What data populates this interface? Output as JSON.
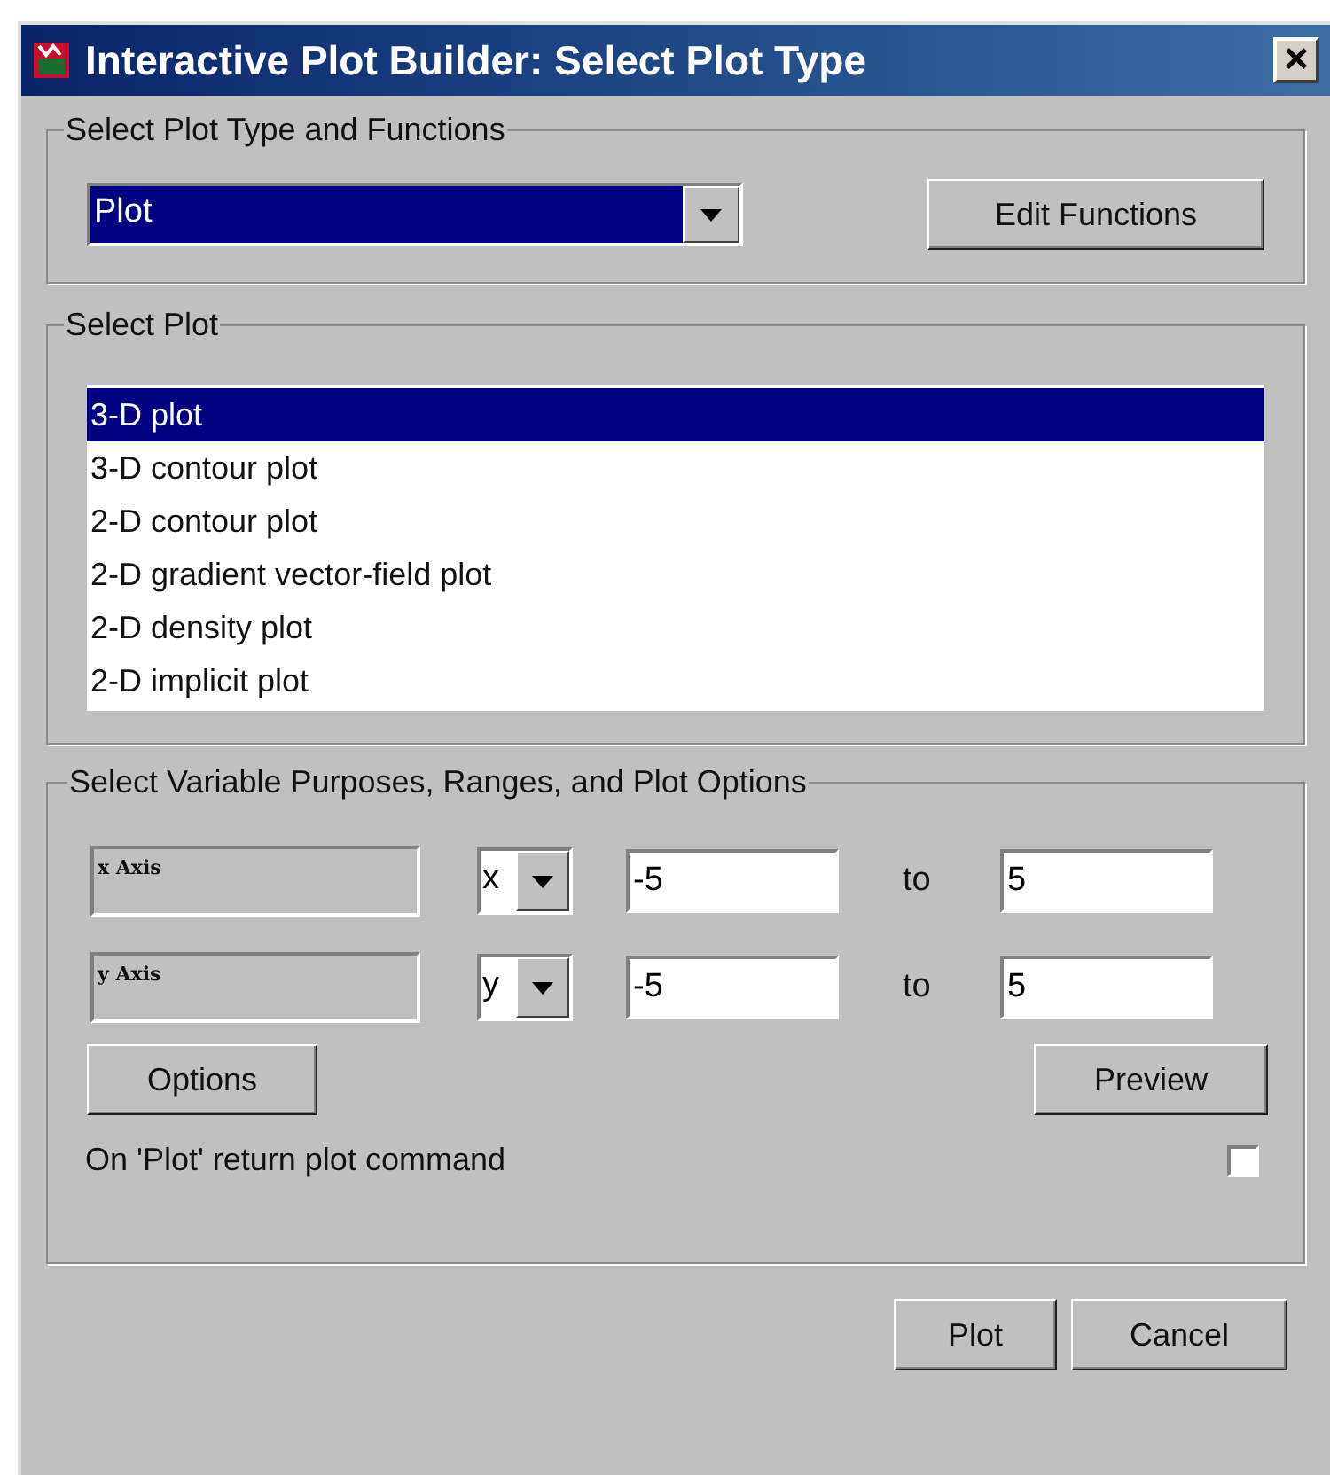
{
  "window": {
    "title": "Interactive Plot Builder: Select Plot Type",
    "close": "×"
  },
  "type_group": {
    "legend": "Select Plot Type and Functions",
    "plot_type": "Plot",
    "edit_button": "Edit Functions"
  },
  "plot_group": {
    "legend": "Select Plot",
    "items": [
      {
        "label": "3-D plot",
        "selected": true
      },
      {
        "label": "3-D contour plot",
        "selected": false
      },
      {
        "label": "2-D contour plot",
        "selected": false
      },
      {
        "label": "2-D gradient vector-field plot",
        "selected": false
      },
      {
        "label": "2-D density plot",
        "selected": false
      },
      {
        "label": "2-D implicit plot",
        "selected": false
      }
    ]
  },
  "variables_group": {
    "legend": "Select Variable Purposes, Ranges, and Plot Options",
    "rows": [
      {
        "purpose": "x Axis",
        "variable": "x",
        "from": "-5",
        "to_label": "to",
        "to": "5"
      },
      {
        "purpose": "y Axis",
        "variable": "y",
        "from": "-5",
        "to_label": "to",
        "to": "5"
      }
    ],
    "options_button": "Options",
    "preview_button": "Preview",
    "return_command": {
      "label": "On 'Plot' return plot command",
      "checked": false
    }
  },
  "buttons": [
    "Plot",
    "Cancel"
  ]
}
